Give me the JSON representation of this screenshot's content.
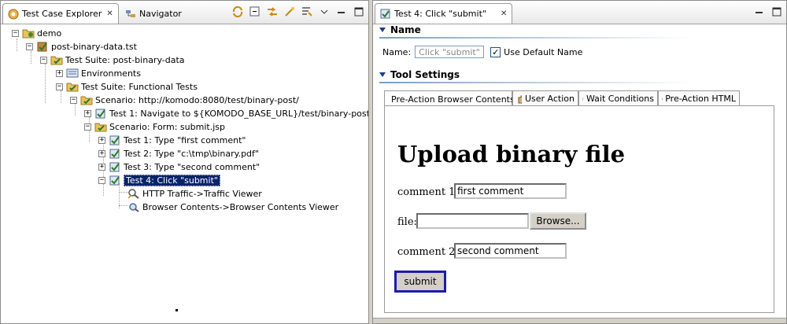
{
  "left_panel": {
    "tabs": [
      {
        "label": "Test Case Explorer",
        "icon": "explorer-icon"
      },
      {
        "label": "Navigator",
        "icon": "navigator-icon"
      }
    ],
    "tree": [
      {
        "label": "demo",
        "icon": "project-icon"
      },
      {
        "label": "post-binary-data.tst",
        "icon": "test-file-icon"
      },
      {
        "label": "Test Suite: post-binary-data",
        "icon": "test-suite-icon"
      },
      {
        "label": "Environments",
        "icon": "environments-icon"
      },
      {
        "label": "Test Suite: Functional Tests",
        "icon": "test-suite-icon"
      },
      {
        "label": "Scenario: http://komodo:8080/test/binary-post/",
        "icon": "scenario-icon"
      },
      {
        "label": "Test 1: Navigate to ${KOMODO_BASE_URL}/test/binary-post/",
        "icon": "test-icon"
      },
      {
        "label": "Scenario: Form: submit.jsp",
        "icon": "scenario-icon"
      },
      {
        "label": "Test 1: Type \"first comment\"",
        "icon": "test-icon"
      },
      {
        "label": "Test 2: Type \"c:\\tmp\\binary.pdf\"",
        "icon": "test-icon"
      },
      {
        "label": "Test 3: Type \"second comment\"",
        "icon": "test-icon"
      },
      {
        "label": "Test 4: Click \"submit\"",
        "icon": "test-icon"
      },
      {
        "label": "HTTP Traffic->Traffic Viewer",
        "icon": "traffic-viewer-icon"
      },
      {
        "label": "Browser Contents->Browser Contents Viewer",
        "icon": "browser-viewer-icon"
      }
    ]
  },
  "right_panel": {
    "tab_label": "Test 4: Click \"submit\"",
    "name_section": {
      "title": "Name",
      "name_label": "Name:",
      "name_value": "Click \"submit\"",
      "use_default_label": "Use Default Name",
      "use_default_checked": true
    },
    "tool_section": {
      "title": "Tool Settings",
      "tabs": [
        "Pre-Action Browser Contents",
        "User Action",
        "Wait Conditions",
        "Pre-Action HTML"
      ]
    },
    "browser": {
      "heading": "Upload binary file",
      "comment1_label": "comment 1:",
      "comment1_value": "first comment",
      "file_label": "file:",
      "file_value": "",
      "browse_label": "Browse...",
      "comment2_label": "comment 2:",
      "comment2_value": "second comment",
      "submit_label": "submit"
    }
  },
  "colors": {
    "selection": "#0a246a",
    "section_accent": "#1a3c8c",
    "submit_focus": "#1c1ca8"
  }
}
